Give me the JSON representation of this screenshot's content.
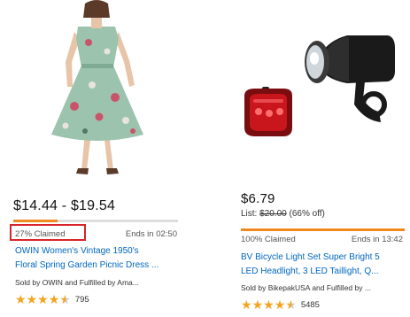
{
  "deals": [
    {
      "image_alt": "sleeveless mint green floral dress",
      "price": "$14.44 - $19.54",
      "claimed_pct": 27,
      "claimed_text": "27% Claimed",
      "ends_text": "Ends in 02:50",
      "title_line1": "OWIN Women's Vintage 1950's",
      "title_line2": "Floral Spring Garden Picnic Dress ...",
      "sold_by": "Sold by OWIN and Fulfilled by Ama...",
      "rating": 4.5,
      "reviews": "795"
    },
    {
      "image_alt": "black bicycle headlight and red taillight",
      "price": "$6.79",
      "list_label": "List: ",
      "list_price": "$20.00",
      "list_savings": " (66% off)",
      "claimed_pct": 100,
      "claimed_text": "100% Claimed",
      "ends_text": "Ends in 13:42",
      "title_line1": "BV Bicycle Light Set Super Bright 5",
      "title_line2": "LED Headlight, 3 LED Taillight, Q...",
      "sold_by": "Sold by BikepakUSA and Fulfilled by ...",
      "rating": 4.5,
      "reviews": "5485"
    }
  ],
  "colors": {
    "link": "#0066c0",
    "progress": "#f0891f",
    "star": "#f4a41c",
    "highlight": "#d9232a"
  },
  "icons": [
    "star-icon"
  ]
}
